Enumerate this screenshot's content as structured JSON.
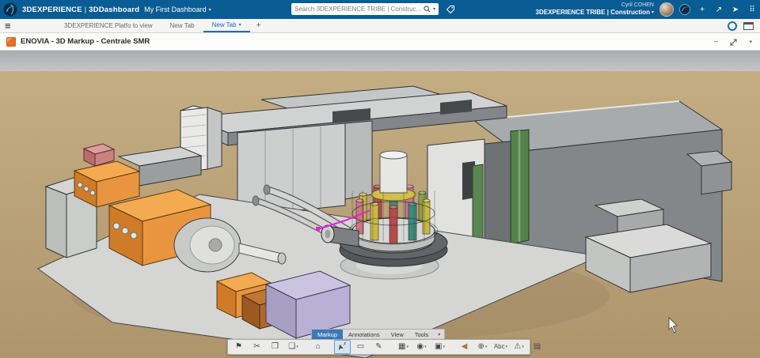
{
  "colors": {
    "header_blue": "#0a5c94",
    "enovia_orange": "#e8702a",
    "active_tab_blue": "#3c79b8",
    "markup_magenta": "#e81fd4"
  },
  "top_bar": {
    "brand": "3DEXPERIENCE",
    "divider": " | ",
    "app_name": "3DDashboard",
    "dashboard_name": "My First Dashboard",
    "chevron": "▾",
    "search_value": "Search 3DEXPERIENCE TRIBE | Construc...",
    "user_name": "Cyril COHEN",
    "tenant": "3DEXPERIENCE TRIBE | Construction",
    "add_glyph": "+",
    "share_glyph": "↗",
    "send_glyph": "➤",
    "apps_glyph": "⠿"
  },
  "tab_bar": {
    "hamburger_glyph": "≡",
    "tab1": "3DEXPERIENCE Platfo to view",
    "tab2": "New Tab",
    "tab3": "New Tab",
    "chevron": "▾",
    "add_tab": "+"
  },
  "app_bar": {
    "title": "ENOVIA - 3D Markup - Centrale SMR",
    "minimize_glyph": "−",
    "collapse_glyph": "▾"
  },
  "markup_toolbar": {
    "tab_markup": "Markup",
    "tab_annotations": "Annotations",
    "tab_view": "View",
    "tab_tools": "Tools",
    "chevron": "▾",
    "buttons": {
      "pen": "⚑",
      "cut": "✂",
      "copy": "❐",
      "paste": "❏",
      "home": "⌂",
      "select": "➤",
      "select_x": "✗",
      "rect": "▭",
      "draw": "✎",
      "image": "▦",
      "stamp": "◉",
      "note": "▣",
      "back": "◀",
      "target": "⊕",
      "text": "Abc",
      "warn": "⚠",
      "lock": "▤"
    }
  }
}
